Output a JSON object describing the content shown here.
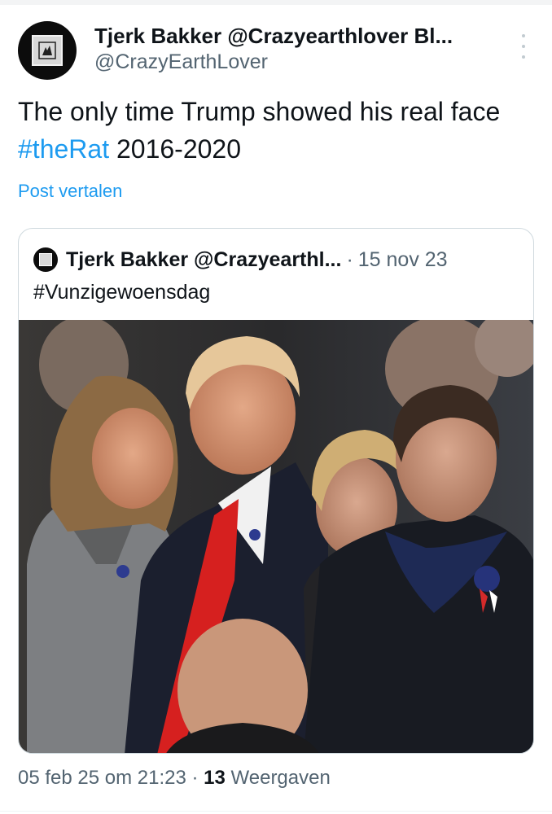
{
  "tweet": {
    "display_name": "Tjerk Bakker @Crazyearthlover Bl...",
    "handle": "@CrazyEarthLover",
    "text_before": "The only time Trump  showed his real face ",
    "hashtag": "#theRat",
    "text_after": " 2016-2020",
    "translate_label": "Post vertalen",
    "timestamp": "05 feb 25 om 21:23",
    "separator": " · ",
    "views_count": "13",
    "views_label": " Weergaven",
    "more_icon": "more-vertical-icon",
    "avatar_icon": "avatar-logo"
  },
  "quoted": {
    "display_name": "Tjerk Bakker @Crazyearthl...",
    "separator": "·",
    "date": "15 nov 23",
    "text": "#Vunzigewoensdag",
    "image_desc_icon": "photo"
  },
  "colors": {
    "link": "#1d9bf0",
    "text": "#0f1419",
    "secondary": "#536471",
    "border": "#cfd9de"
  }
}
